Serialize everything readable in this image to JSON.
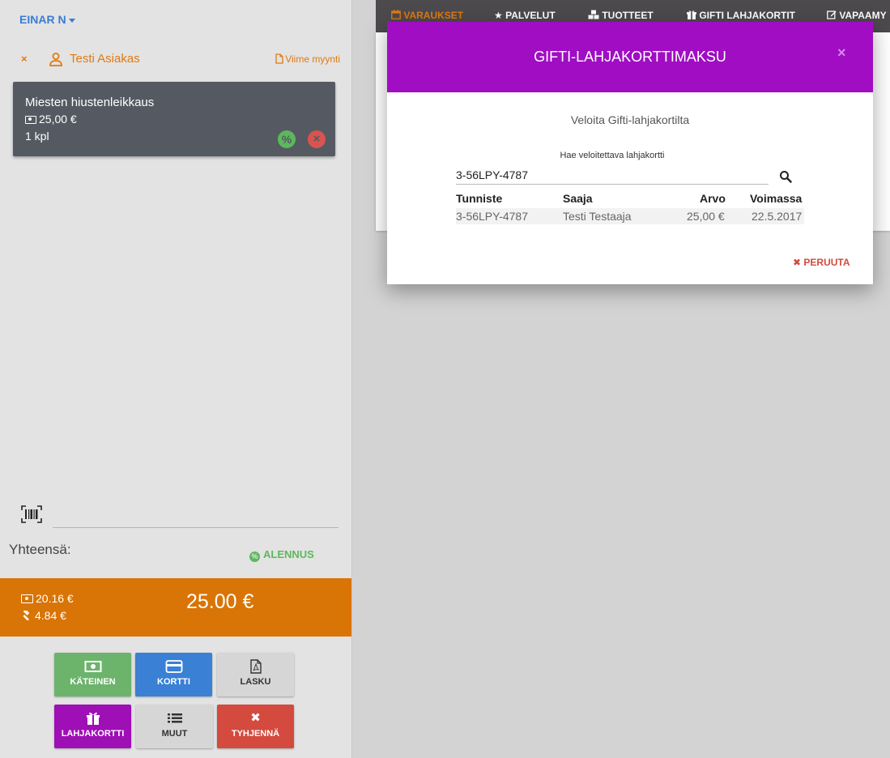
{
  "user": {
    "name": "EINAR N"
  },
  "customer": {
    "remove_symbol": "×",
    "name": "Testi Asiakas",
    "last_sale": "Viime myynti"
  },
  "cart": {
    "items": [
      {
        "name": "Miesten hiustenleikkaus",
        "price": "25,00 €",
        "qty": "1 kpl",
        "discount_symbol": "%",
        "remove_symbol": "×"
      }
    ]
  },
  "barcode": {
    "value": ""
  },
  "totals": {
    "label": "Yhteensä:",
    "discount_label": "ALENNUS",
    "net": "20.16 €",
    "tax": "4.84 €",
    "grand": "25.00 €"
  },
  "buttons": {
    "cash": "KÄTEINEN",
    "card": "KORTTI",
    "invoice": "LASKU",
    "giftcard": "LAHJAKORTTI",
    "other": "MUUT",
    "clear": "TYHJENNÄ",
    "clear_symbol": "✖"
  },
  "nav": {
    "items": [
      "VARAUKSET",
      "PALVELUT",
      "TUOTTEET",
      "GIFTI LAHJAKORTIT",
      "VAPAAMY"
    ]
  },
  "modal": {
    "title": "GIFTI-LAHJAKORTTIMAKSU",
    "close_symbol": "×",
    "subtitle": "Veloita Gifti-lahjakortilta",
    "search_label": "Hae veloitettava lahjakortti",
    "search_value": "3-56LPY-4787",
    "table": {
      "headers": [
        "Tunniste",
        "Saaja",
        "Arvo",
        "Voimassa"
      ],
      "rows": [
        [
          "3-56LPY-4787",
          "Testi Testaaja",
          "25,00 €",
          "22.5.2017"
        ]
      ]
    },
    "cancel_symbol": "✖",
    "cancel_label": "PERUUTA"
  },
  "colors": {
    "accent_orange": "#d97406",
    "modal_purple": "#a00dc3",
    "link_blue": "#3a7bd5",
    "discount_green": "#5cb85c",
    "danger_red": "#d44a3e"
  }
}
